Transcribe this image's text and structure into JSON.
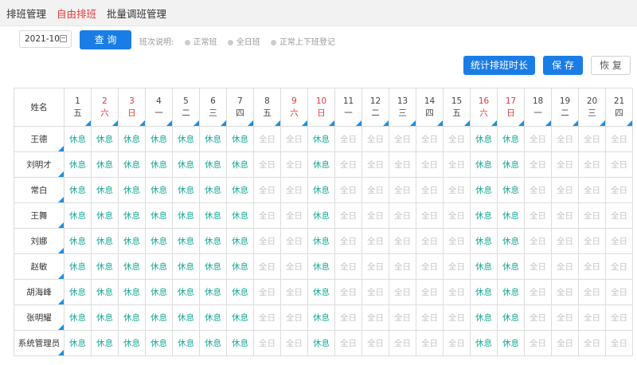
{
  "tabs": [
    {
      "label": "排班管理",
      "active": false
    },
    {
      "label": "自由排班",
      "active": true
    },
    {
      "label": "批量调班管理",
      "active": false
    }
  ],
  "toolbar": {
    "month_value": "2021-10",
    "query_label": "查 询",
    "legend_title": "班次说明:",
    "legend_items": [
      "正常班",
      "全日班",
      "正常上下班登记"
    ],
    "stats_label": "统计排班时长",
    "save_label": "保 存",
    "restore_label": "恢 复"
  },
  "colors": {
    "accent": "#1a7de6",
    "weekend": "#e4393c",
    "rest": "#19a89a",
    "full": "#c4c4c4"
  },
  "table": {
    "name_header": "姓名",
    "days": [
      {
        "num": "1",
        "weekday": "五",
        "weekend": false
      },
      {
        "num": "2",
        "weekday": "六",
        "weekend": true
      },
      {
        "num": "3",
        "weekday": "日",
        "weekend": true
      },
      {
        "num": "4",
        "weekday": "一",
        "weekend": false
      },
      {
        "num": "5",
        "weekday": "二",
        "weekend": false
      },
      {
        "num": "6",
        "weekday": "三",
        "weekend": false
      },
      {
        "num": "7",
        "weekday": "四",
        "weekend": false
      },
      {
        "num": "8",
        "weekday": "五",
        "weekend": false
      },
      {
        "num": "9",
        "weekday": "六",
        "weekend": true
      },
      {
        "num": "10",
        "weekday": "日",
        "weekend": true
      },
      {
        "num": "11",
        "weekday": "一",
        "weekend": false
      },
      {
        "num": "12",
        "weekday": "二",
        "weekend": false
      },
      {
        "num": "13",
        "weekday": "三",
        "weekend": false
      },
      {
        "num": "14",
        "weekday": "四",
        "weekend": false
      },
      {
        "num": "15",
        "weekday": "五",
        "weekend": false
      },
      {
        "num": "16",
        "weekday": "六",
        "weekend": true
      },
      {
        "num": "17",
        "weekday": "日",
        "weekend": true
      },
      {
        "num": "18",
        "weekday": "一",
        "weekend": false
      },
      {
        "num": "19",
        "weekday": "二",
        "weekend": false
      },
      {
        "num": "20",
        "weekday": "三",
        "weekend": false
      },
      {
        "num": "21",
        "weekday": "四",
        "weekend": false
      }
    ],
    "rows": [
      {
        "name": "王德",
        "shifts": [
          "休息",
          "休息",
          "休息",
          "休息",
          "休息",
          "休息",
          "休息",
          "全日",
          "全日",
          "休息",
          "全日",
          "全日",
          "全日",
          "全日",
          "全日",
          "休息",
          "休息",
          "全日",
          "全日",
          "全日",
          "全日"
        ]
      },
      {
        "name": "刘明才",
        "shifts": [
          "休息",
          "休息",
          "休息",
          "休息",
          "休息",
          "休息",
          "休息",
          "全日",
          "全日",
          "休息",
          "全日",
          "全日",
          "全日",
          "全日",
          "全日",
          "休息",
          "休息",
          "全日",
          "全日",
          "全日",
          "全日"
        ]
      },
      {
        "name": "常白",
        "shifts": [
          "休息",
          "休息",
          "休息",
          "休息",
          "休息",
          "休息",
          "休息",
          "全日",
          "全日",
          "休息",
          "全日",
          "全日",
          "全日",
          "全日",
          "全日",
          "休息",
          "休息",
          "全日",
          "全日",
          "全日",
          "全日"
        ]
      },
      {
        "name": "王舞",
        "shifts": [
          "休息",
          "休息",
          "休息",
          "休息",
          "休息",
          "休息",
          "休息",
          "全日",
          "全日",
          "休息",
          "全日",
          "全日",
          "全日",
          "全日",
          "全日",
          "休息",
          "休息",
          "全日",
          "全日",
          "全日",
          "全日"
        ]
      },
      {
        "name": "刘娜",
        "shifts": [
          "休息",
          "休息",
          "休息",
          "休息",
          "休息",
          "休息",
          "休息",
          "全日",
          "全日",
          "休息",
          "全日",
          "全日",
          "全日",
          "全日",
          "全日",
          "休息",
          "休息",
          "全日",
          "全日",
          "全日",
          "全日"
        ]
      },
      {
        "name": "赵敏",
        "shifts": [
          "休息",
          "休息",
          "休息",
          "休息",
          "休息",
          "休息",
          "休息",
          "全日",
          "全日",
          "休息",
          "全日",
          "全日",
          "全日",
          "全日",
          "全日",
          "休息",
          "休息",
          "全日",
          "全日",
          "全日",
          "全日"
        ]
      },
      {
        "name": "胡海峰",
        "shifts": [
          "休息",
          "休息",
          "休息",
          "休息",
          "休息",
          "休息",
          "休息",
          "全日",
          "全日",
          "休息",
          "全日",
          "全日",
          "全日",
          "全日",
          "全日",
          "休息",
          "休息",
          "全日",
          "全日",
          "全日",
          "全日"
        ]
      },
      {
        "name": "张明耀",
        "shifts": [
          "休息",
          "休息",
          "休息",
          "休息",
          "休息",
          "休息",
          "休息",
          "全日",
          "全日",
          "休息",
          "全日",
          "全日",
          "全日",
          "全日",
          "全日",
          "休息",
          "休息",
          "全日",
          "全日",
          "全日",
          "全日"
        ]
      },
      {
        "name": "系统管理员",
        "shifts": [
          "休息",
          "休息",
          "休息",
          "休息",
          "休息",
          "休息",
          "休息",
          "全日",
          "全日",
          "休息",
          "全日",
          "全日",
          "全日",
          "全日",
          "全日",
          "休息",
          "休息",
          "全日",
          "全日",
          "全日",
          "全日"
        ]
      }
    ]
  }
}
